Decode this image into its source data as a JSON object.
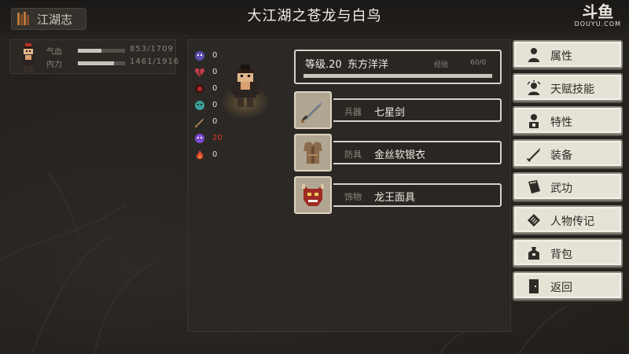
{
  "window": {
    "title": "大江湖之苍龙与白鸟"
  },
  "app_badge": {
    "label": "江湖志"
  },
  "watermark": {
    "logo": "斗鱼",
    "domain": "DOUYU.COM"
  },
  "character": {
    "hp": {
      "label": "气血",
      "value": "853/1709",
      "fraction": 0.5
    },
    "mp": {
      "label": "内力",
      "value": "1461/1916",
      "fraction": 0.76
    }
  },
  "resources": [
    {
      "icon": "skull-icon",
      "count": "0",
      "color": "#5a4fb0"
    },
    {
      "icon": "broken-heart-icon",
      "count": "0",
      "color": "#c23a4a"
    },
    {
      "icon": "red-orb-icon",
      "count": "0",
      "color": "#b82828"
    },
    {
      "icon": "teal-skull-icon",
      "count": "0",
      "color": "#3ca09a"
    },
    {
      "icon": "dagger-icon",
      "count": "0",
      "color": "#c8a060"
    },
    {
      "icon": "purple-skull-icon",
      "count": "20",
      "color": "#7a4ad0",
      "highlight": true
    },
    {
      "icon": "flame-icon",
      "count": "0",
      "color": "#d84828"
    }
  ],
  "level": {
    "text": "等级.20",
    "name": "东方洋洋",
    "exp_label": "经验",
    "exp_value": "60/0",
    "exp_fraction": 1.0
  },
  "equipment": [
    {
      "slot": "兵器",
      "name": "七星剑",
      "icon": "sword-icon"
    },
    {
      "slot": "防具",
      "name": "金丝软银衣",
      "icon": "armor-icon"
    },
    {
      "slot": "饰物",
      "name": "龙王面具",
      "icon": "dragon-mask-icon"
    }
  ],
  "menu": [
    {
      "label": "属性",
      "icon": "person-icon"
    },
    {
      "label": "天赋技能",
      "icon": "talent-icon"
    },
    {
      "label": "特性",
      "icon": "trait-icon"
    },
    {
      "label": "装备",
      "icon": "sword-icon"
    },
    {
      "label": "武功",
      "icon": "book-icon"
    },
    {
      "label": "人物传记",
      "icon": "scroll-icon"
    },
    {
      "label": "背包",
      "icon": "bag-icon"
    },
    {
      "label": "返回",
      "icon": "door-icon"
    }
  ],
  "colors": {
    "accent_text": "#f0ebe3",
    "panel": "#2b2825",
    "menu_button": "#e7e2d6",
    "hp_bar": "#c9c4bc"
  }
}
